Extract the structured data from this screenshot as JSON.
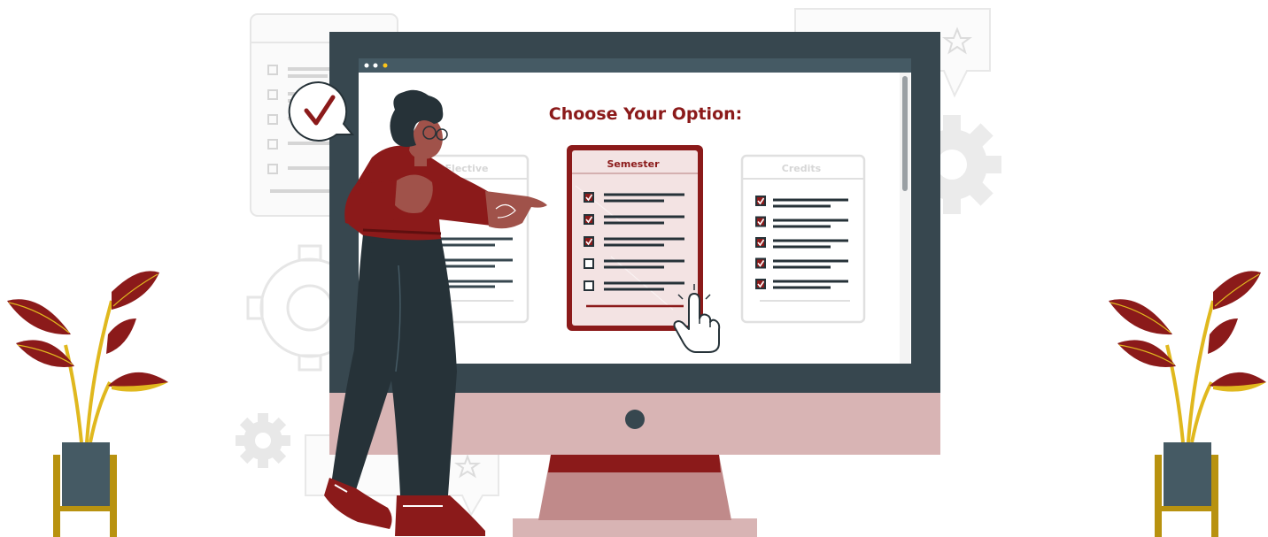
{
  "heading": "Choose Your Option:",
  "cards": [
    {
      "title": "Elective",
      "checked": [
        true,
        true,
        true,
        true,
        true
      ],
      "selected": false
    },
    {
      "title": "Semester",
      "checked": [
        true,
        true,
        true,
        false,
        false
      ],
      "selected": true
    },
    {
      "title": "Credits",
      "checked": [
        true,
        true,
        true,
        true,
        true
      ],
      "selected": false
    }
  ],
  "colors": {
    "accent": "#8b1a1a",
    "monitor_frame": "#37474f",
    "monitor_chin": "#d8b4b4",
    "stand": "#c08a8a",
    "gold": "#b8920f",
    "background_gray": "#ebebeb"
  },
  "icons": [
    "checkmark-icon",
    "star-icon",
    "gear-icon",
    "pointer-hand-icon",
    "checkbox-icon"
  ]
}
